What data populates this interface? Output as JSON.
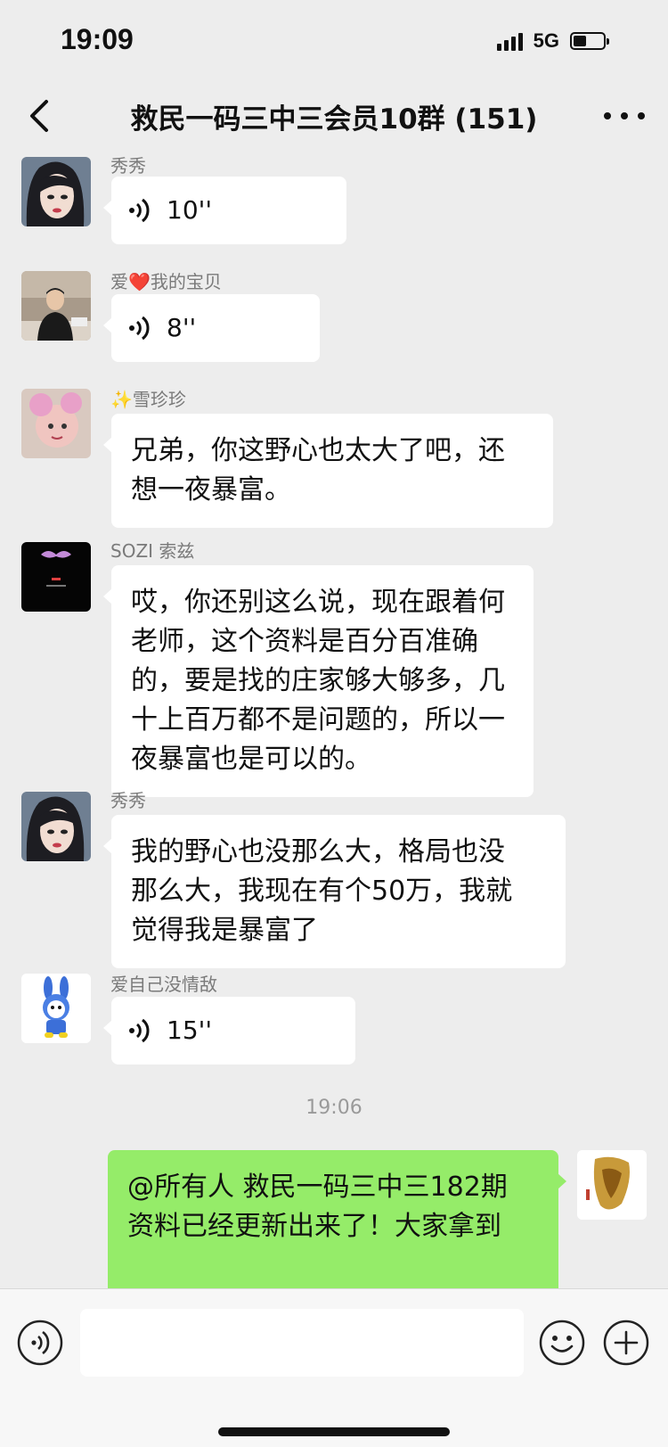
{
  "status": {
    "time": "19:09",
    "network": "5G",
    "battery_level": 0.45
  },
  "nav": {
    "title": "救民一码三中三会员10群 (151)"
  },
  "messages": [
    {
      "sender": "秀秀",
      "type": "voice",
      "duration": "10''"
    },
    {
      "sender": "爱❤️我的宝贝",
      "type": "voice",
      "duration": "8''"
    },
    {
      "sender": "✨雪珍珍",
      "type": "text",
      "lines": [
        "兄弟，你这野心也太大了吧，还",
        "想一夜暴富。"
      ]
    },
    {
      "sender": "SOZI 索兹",
      "type": "text",
      "lines": [
        "哎，你还别这么说，现在跟着何",
        "老师，这个资料是百分百准确",
        "的，要是找的庄家够大够多，几",
        "十上百万都不是问题的，所以一",
        "夜暴富也是可以的。"
      ]
    },
    {
      "sender": "秀秀",
      "type": "text",
      "lines": [
        "我的野心也没那么大，格局也没",
        "那么大，我现在有个50万，我就",
        "觉得我是暴富了"
      ]
    },
    {
      "sender": "爱自己没情敌",
      "type": "voice",
      "duration": "15''"
    }
  ],
  "divider_time": "19:06",
  "self_message": {
    "lines": [
      "@所有人  救民一码三中三182期",
      "资料已经更新出来了！大家拿到"
    ]
  },
  "input": {
    "value": "",
    "placeholder": ""
  },
  "colors": {
    "self_bubble": "#95ec69",
    "background": "#ededed"
  }
}
